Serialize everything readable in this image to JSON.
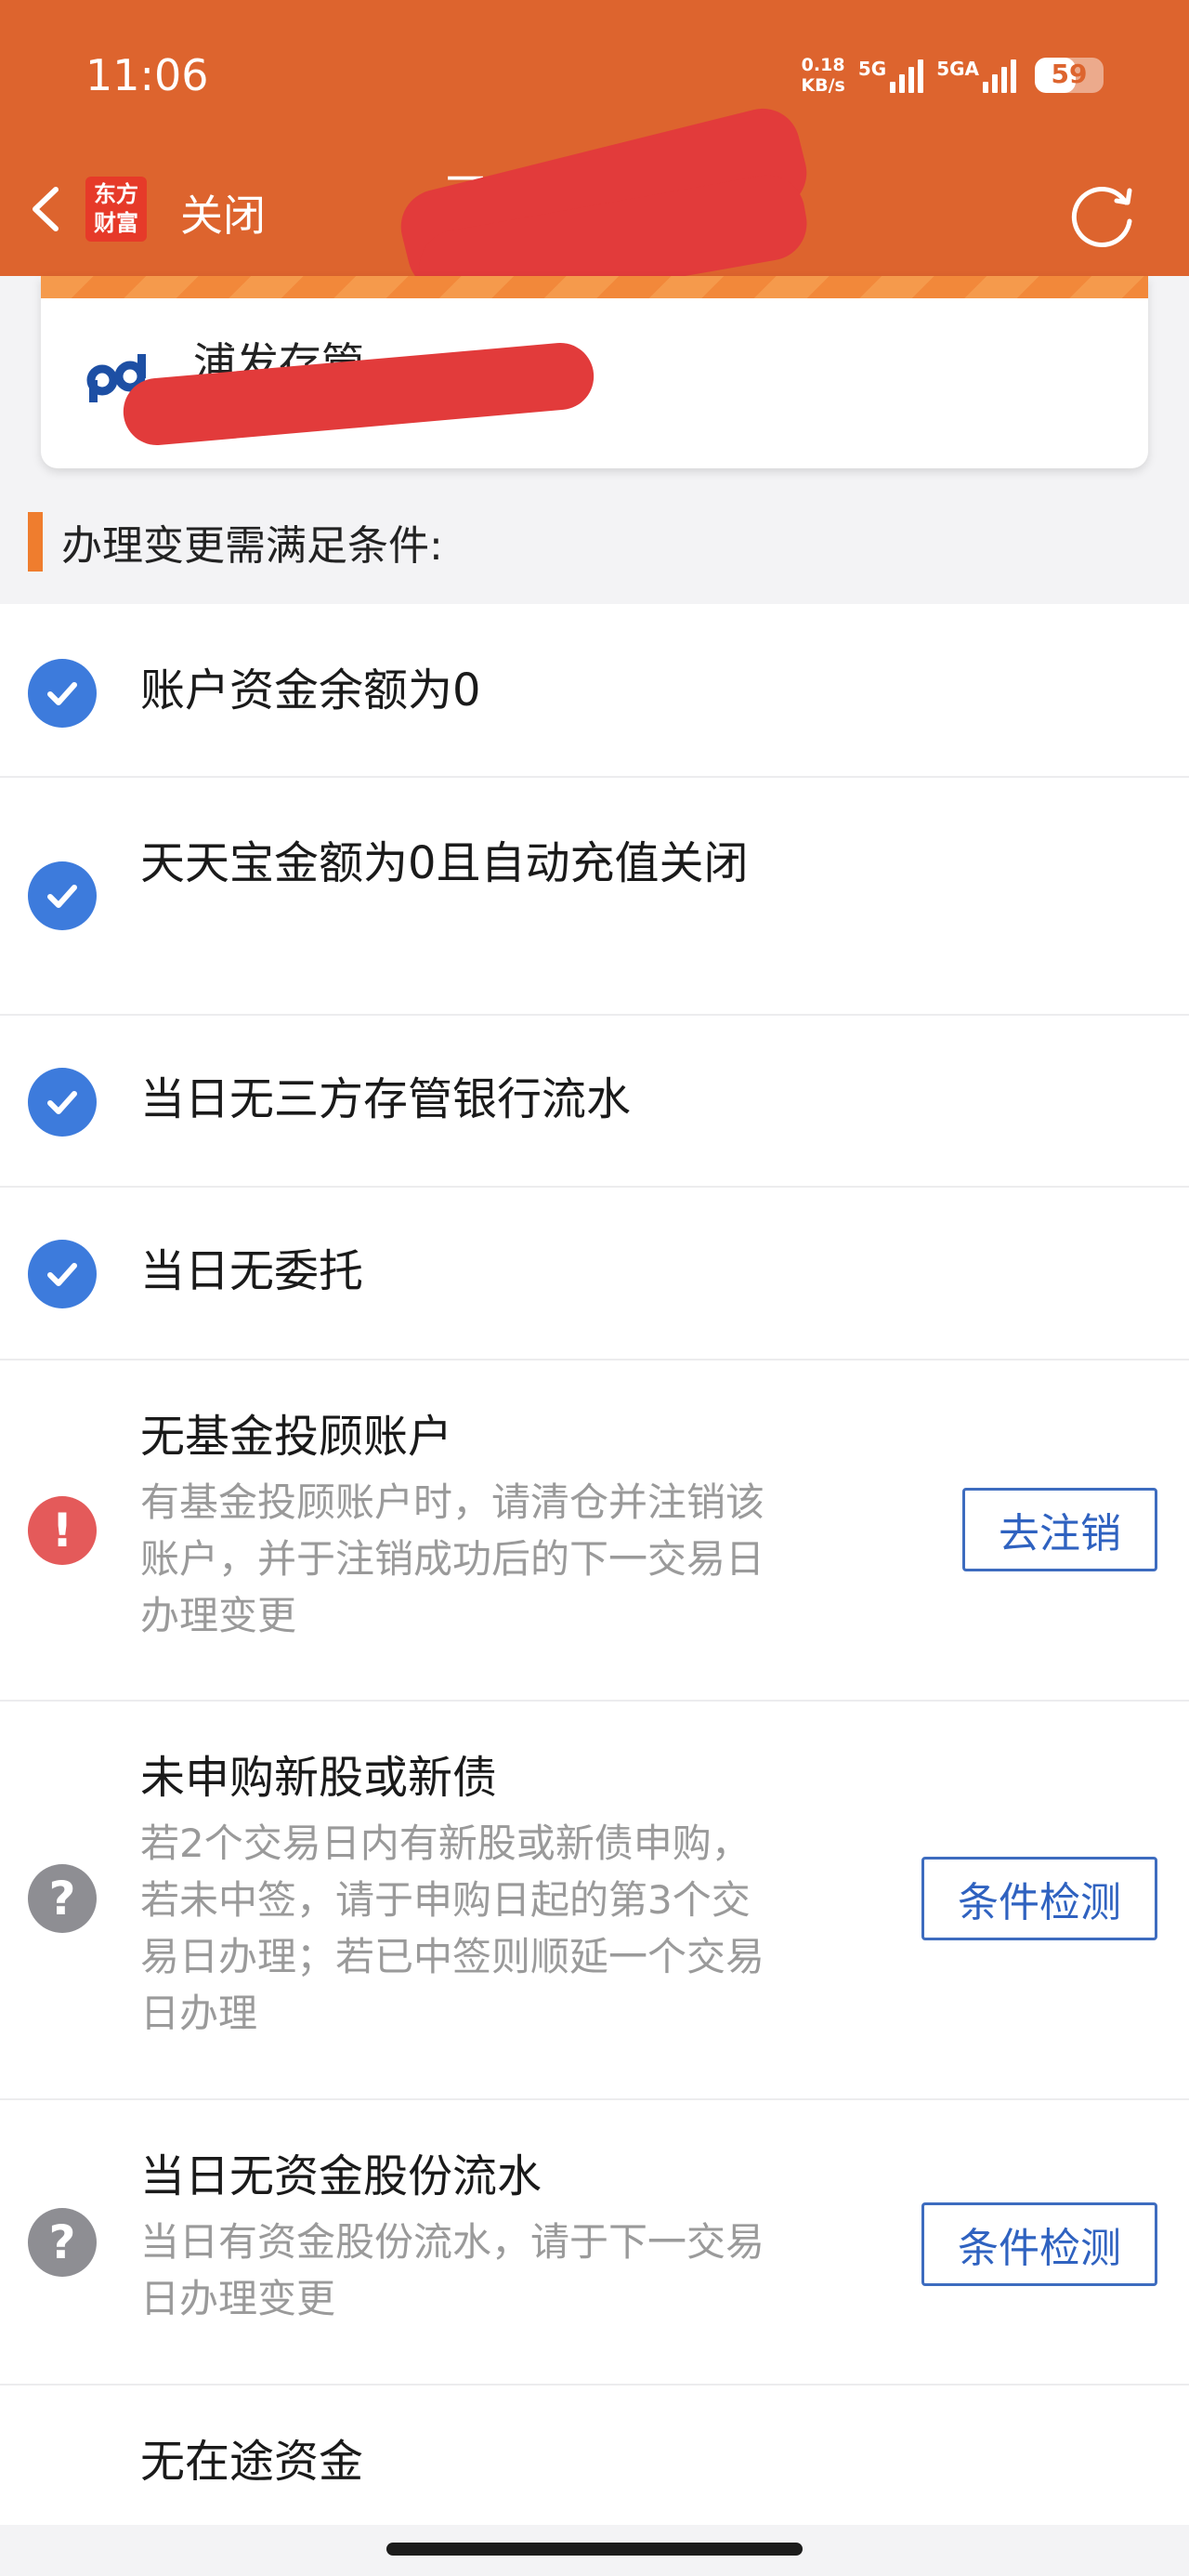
{
  "status_bar": {
    "time": "11:06",
    "speed_value": "0.18",
    "speed_unit": "KB/s",
    "network_1": "5G",
    "network_2": "5GA",
    "battery": "59"
  },
  "nav": {
    "logo_line1": "东方",
    "logo_line2": "财富",
    "close_label": "关闭",
    "title": "三方存"
  },
  "bank_card": {
    "bank_name": "浦发存管"
  },
  "section": {
    "title": "办理变更需满足条件:"
  },
  "conditions": [
    {
      "status": "ok",
      "title": "账户资金余额为0"
    },
    {
      "status": "ok",
      "title": "天天宝金额为0且自动充值关闭"
    },
    {
      "status": "ok",
      "title": "当日无三方存管银行流水"
    },
    {
      "status": "ok",
      "title": "当日无委托"
    },
    {
      "status": "error",
      "title": "无基金投顾账户",
      "desc": "有基金投顾账户时，请清仓并注销该账户，并于注销成功后的下一交易日办理变更",
      "button": "去注销"
    },
    {
      "status": "unknown",
      "title": "未申购新股或新债",
      "desc": "若2个交易日内有新股或新债申购，若未中签，请于申购日起的第3个交易日办理；若已中签则顺延一个交易日办理",
      "button": "条件检测"
    },
    {
      "status": "unknown",
      "title": "当日无资金股份流水",
      "desc": "当日有资金股份流水，请于下一交易日办理变更",
      "button": "条件检测"
    },
    {
      "status": "unknown",
      "title": "无在途资金"
    }
  ],
  "colors": {
    "header": "#dd642e",
    "accent_blue": "#3d7bdc",
    "error_red": "#e45a5a",
    "unknown_gray": "#8e8e93",
    "section_bar": "#ef7d2e"
  },
  "icons": {
    "back": "chevron-left-icon",
    "refresh": "refresh-icon",
    "ok": "check-circle-icon",
    "error": "exclamation-circle-icon",
    "unknown": "question-circle-icon"
  }
}
